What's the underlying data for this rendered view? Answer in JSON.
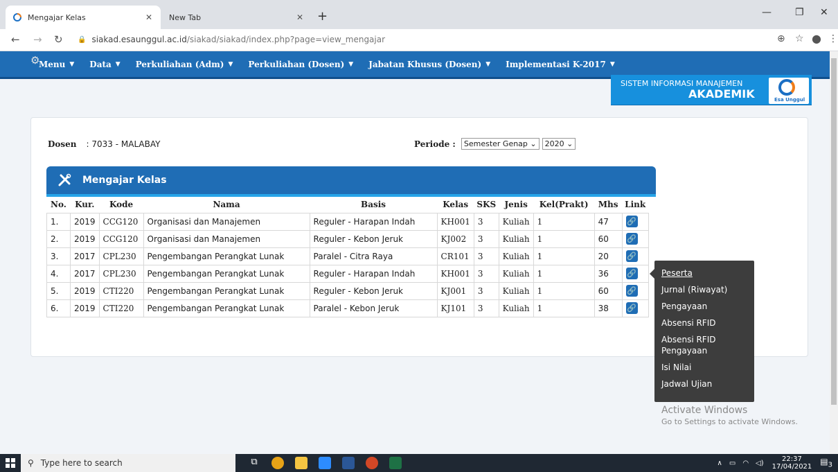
{
  "browser": {
    "tabs": [
      {
        "label": "Mengajar Kelas"
      },
      {
        "label": "New Tab"
      }
    ],
    "url_host": "siakad.esaunggul.ac.id",
    "url_path": "/siakad/siakad/index.php?page=view_mengajar"
  },
  "topnav": {
    "items": [
      {
        "label": "Menu"
      },
      {
        "label": "Data"
      },
      {
        "label": "Perkuliahan (Adm)"
      },
      {
        "label": "Perkuliahan (Dosen)"
      },
      {
        "label": "Jabatan Khusus (Dosen)"
      },
      {
        "label": "Implementasi K-2017"
      }
    ]
  },
  "banner": {
    "line1": "SISTEM INFORMASI MANAJEMEN",
    "line2": "AKADEMIK",
    "logo_text": "Esa Unggul"
  },
  "dosen": {
    "label": "Dosen",
    "value": ": 7033 - MALABAY"
  },
  "periode": {
    "label": "Periode :",
    "semester": "Semester Genap",
    "year": "2020"
  },
  "panel": {
    "title": "Mengajar Kelas"
  },
  "table": {
    "headers": [
      "No.",
      "Kur.",
      "Kode",
      "Nama",
      "Basis",
      "Kelas",
      "SKS",
      "Jenis",
      "Kel(Prakt)",
      "Mhs",
      "Link"
    ],
    "rows": [
      {
        "no": "1.",
        "kur": "2019",
        "kode": "CCG120",
        "nama": "Organisasi dan Manajemen",
        "basis": "Reguler - Harapan Indah",
        "kelas": "KH001",
        "sks": "3",
        "jenis": "Kuliah",
        "kel": "1",
        "mhs": "47"
      },
      {
        "no": "2.",
        "kur": "2019",
        "kode": "CCG120",
        "nama": "Organisasi dan Manajemen",
        "basis": "Reguler - Kebon Jeruk",
        "kelas": "KJ002",
        "sks": "3",
        "jenis": "Kuliah",
        "kel": "1",
        "mhs": "60"
      },
      {
        "no": "3.",
        "kur": "2017",
        "kode": "CPL230",
        "nama": "Pengembangan Perangkat Lunak",
        "basis": "Paralel - Citra Raya",
        "kelas": "CR101",
        "sks": "3",
        "jenis": "Kuliah",
        "kel": "1",
        "mhs": "20"
      },
      {
        "no": "4.",
        "kur": "2017",
        "kode": "CPL230",
        "nama": "Pengembangan Perangkat Lunak",
        "basis": "Reguler - Harapan Indah",
        "kelas": "KH001",
        "sks": "3",
        "jenis": "Kuliah",
        "kel": "1",
        "mhs": "36"
      },
      {
        "no": "5.",
        "kur": "2019",
        "kode": "CTI220",
        "nama": "Pengembangan Perangkat Lunak",
        "basis": "Reguler - Kebon Jeruk",
        "kelas": "KJ001",
        "sks": "3",
        "jenis": "Kuliah",
        "kel": "1",
        "mhs": "60"
      },
      {
        "no": "6.",
        "kur": "2019",
        "kode": "CTI220",
        "nama": "Pengembangan Perangkat Lunak",
        "basis": "Paralel - Kebon Jeruk",
        "kelas": "KJ101",
        "sks": "3",
        "jenis": "Kuliah",
        "kel": "1",
        "mhs": "38"
      }
    ]
  },
  "dropdown": {
    "items": [
      {
        "label": "Peserta"
      },
      {
        "label": "Jurnal (Riwayat)"
      },
      {
        "label": "Pengayaan"
      },
      {
        "label": "Absensi RFID"
      },
      {
        "label": "Absensi RFID Pengayaan"
      },
      {
        "label": "Isi Nilai"
      },
      {
        "label": "Jadwal Ujian"
      }
    ]
  },
  "watermark": {
    "title": "Activate Windows",
    "subtitle": "Go to Settings to activate Windows."
  },
  "taskbar": {
    "search_placeholder": "Type here to search",
    "time": "22:37",
    "date": "17/04/2021",
    "notif_count": "3"
  },
  "colors": {
    "nav_blue": "#1f6db5",
    "banner_blue": "#1790dd",
    "panel_accent": "#27a4e8"
  }
}
